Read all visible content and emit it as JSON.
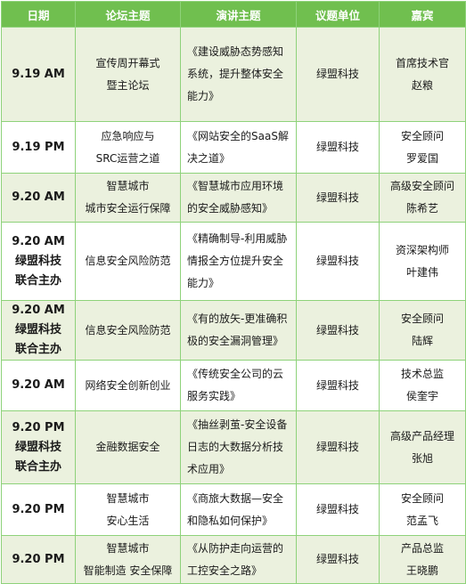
{
  "headers": [
    "日期",
    "论坛主题",
    "演讲主题",
    "议题单位",
    "嘉宾"
  ],
  "rows": [
    {
      "date": [
        "9.19 AM"
      ],
      "forum": [
        "宣传周开幕式",
        "暨主论坛"
      ],
      "talk": [
        "《建设威胁态势感知",
        "系统，提升整体安全",
        "能力》"
      ],
      "unit": "绿盟科技",
      "guest": [
        "首席技术官",
        "赵粮"
      ]
    },
    {
      "date": [
        "9.19 PM"
      ],
      "forum": [
        "应急响应与",
        "SRC运营之道"
      ],
      "talk": [
        "《网站安全的SaaS解",
        "决之道》"
      ],
      "unit": "绿盟科技",
      "guest": [
        "安全顾问",
        "罗爱国"
      ]
    },
    {
      "date": [
        "9.20 AM"
      ],
      "forum": [
        "智慧城市",
        "城市安全运行保障"
      ],
      "talk": [
        "《智慧城市应用环境",
        "的安全威胁感知》"
      ],
      "unit": "绿盟科技",
      "guest": [
        "高级安全顾问",
        "陈希艺"
      ]
    },
    {
      "date": [
        "9.20 AM",
        "绿盟科技",
        "联合主办"
      ],
      "forum": [
        "信息安全风险防范"
      ],
      "talk": [
        "《精确制导-利用威胁",
        "情报全方位提升安全",
        "能力》"
      ],
      "unit": "绿盟科技",
      "guest": [
        "资深架构师",
        "叶建伟"
      ]
    },
    {
      "date": [
        "9.20 AM",
        "绿盟科技",
        "联合主办"
      ],
      "forum": [
        "信息安全风险防范"
      ],
      "talk": [
        "《有的放矢-更准确积",
        "极的安全漏洞管理》"
      ],
      "unit": "绿盟科技",
      "guest": [
        "安全顾问",
        "陆辉"
      ]
    },
    {
      "date": [
        "9.20 AM"
      ],
      "forum": [
        "网络安全创新创业"
      ],
      "talk": [
        "《传统安全公司的云",
        "服务实践》"
      ],
      "unit": "绿盟科技",
      "guest": [
        "技术总监",
        "侯奎宇"
      ]
    },
    {
      "date": [
        "9.20 PM",
        "绿盟科技",
        "联合主办"
      ],
      "forum": [
        "金融数据安全"
      ],
      "talk": [
        "《抽丝剥茧-安全设备",
        "日志的大数据分析技",
        "术应用》"
      ],
      "unit": "绿盟科技",
      "guest": [
        "高级产品经理",
        "张旭"
      ]
    },
    {
      "date": [
        "9.20 PM"
      ],
      "forum": [
        "智慧城市",
        "安心生活"
      ],
      "talk": [
        "《商旅大数据—安全",
        "和隐私如何保护》"
      ],
      "unit": "绿盟科技",
      "guest": [
        "安全顾问",
        "范孟飞"
      ]
    },
    {
      "date": [
        "9.20 PM"
      ],
      "forum": [
        "智慧城市",
        "智能制造 安全保障"
      ],
      "talk": [
        "《从防护走向运营的",
        "工控安全之路》"
      ],
      "unit": "绿盟科技",
      "guest": [
        "产品总监",
        "王晓鹏"
      ]
    }
  ]
}
